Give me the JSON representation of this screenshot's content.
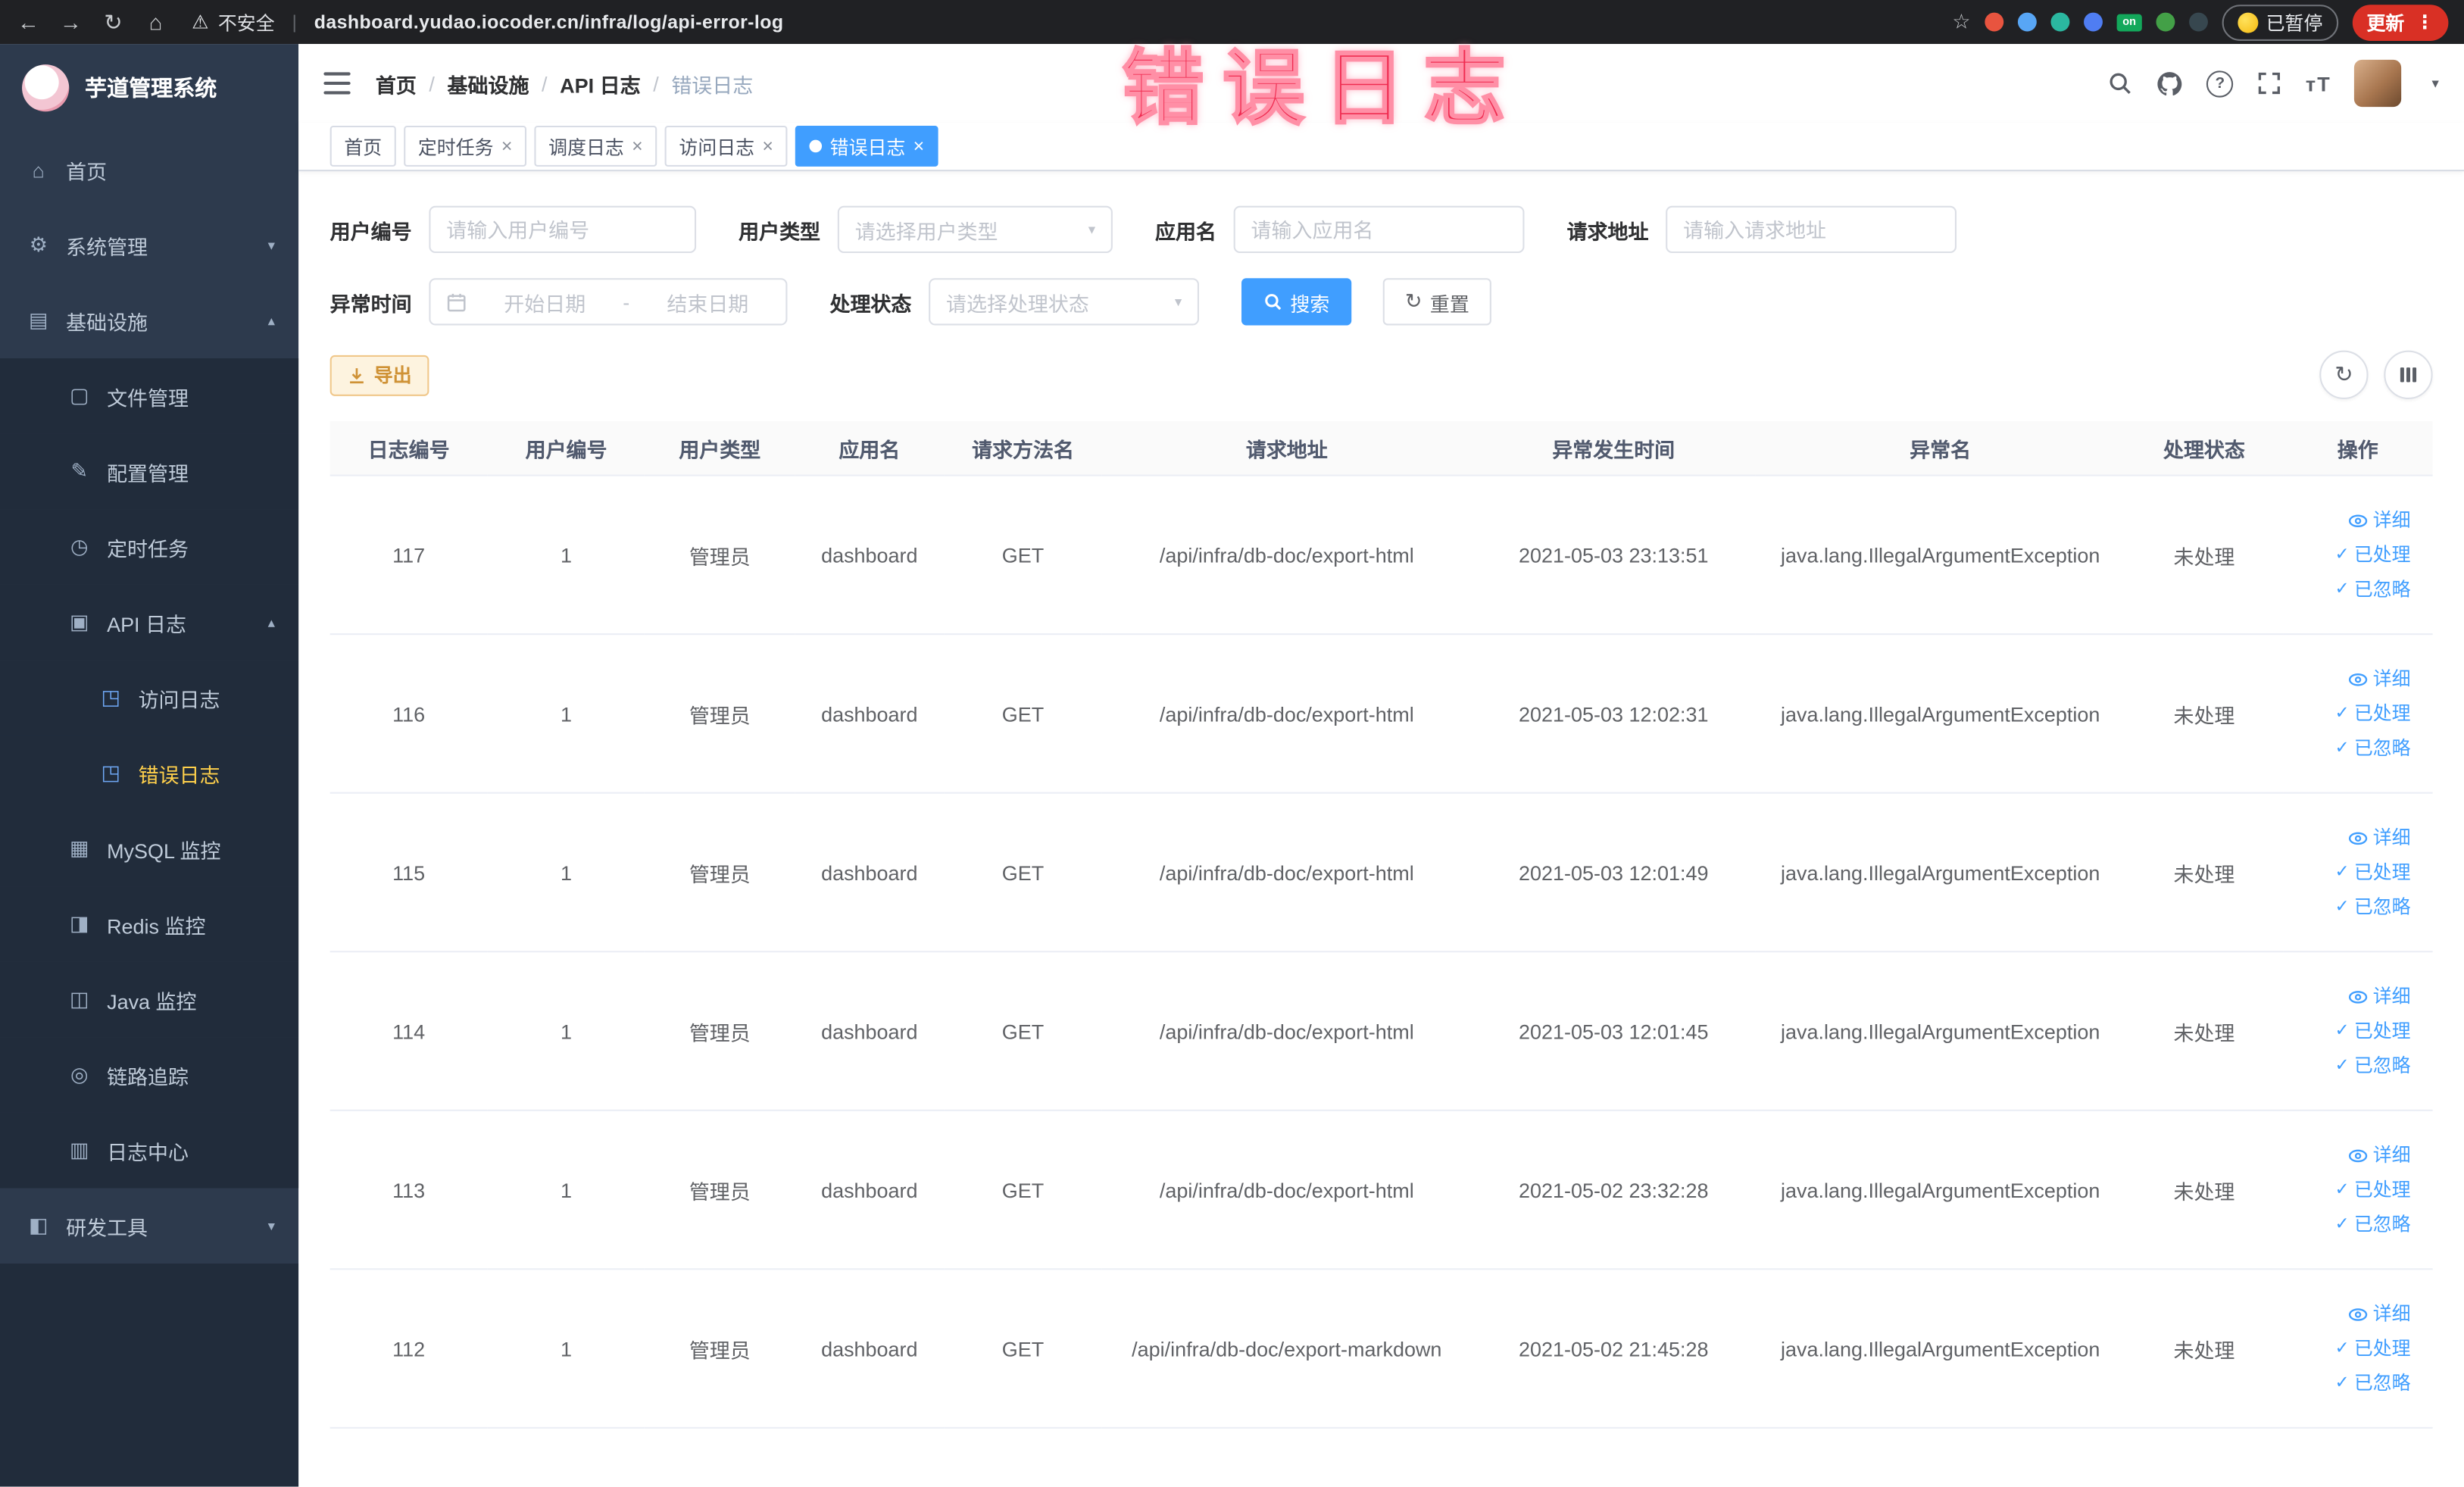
{
  "browser": {
    "back_glyph": "←",
    "forward_glyph": "→",
    "reload_glyph": "↻",
    "home_glyph": "⌂",
    "warning_glyph": "⚠",
    "security_warning": "不安全",
    "url": "dashboard.yudao.iocoder.cn/infra/log/api-error-log",
    "star_glyph": "☆",
    "extensions": [
      {
        "name": "extension-red",
        "color": "#e8543f"
      },
      {
        "name": "extension-blue",
        "color": "#58a6f5"
      },
      {
        "name": "extension-teal",
        "color": "#2bb7a0"
      },
      {
        "name": "extension-grid",
        "color": "#4f7df2"
      },
      {
        "name": "extension-on-badge",
        "color": "#13a85b",
        "text": "on"
      },
      {
        "name": "extension-green",
        "color": "#43a047"
      },
      {
        "name": "extension-dark",
        "color": "#37474f"
      }
    ],
    "paused_label": "已暂停",
    "update_label": "更新",
    "menu_dots_glyph": "⋮"
  },
  "overlay_title": "错误日志",
  "sidebar": {
    "logo_title": "芋道管理系统",
    "chevron_up": "▴",
    "chevron_down": "▾",
    "icon_glyphs": {
      "home-icon": "⌂",
      "gear-icon": "⚙",
      "infrastructure-icon": "▤",
      "file-icon": "▢",
      "config-icon": "✎",
      "timer-icon": "◷",
      "api-log-icon": "▣",
      "access-log-icon": "◳",
      "error-log-icon": "◳",
      "mysql-icon": "▦",
      "redis-icon": "◨",
      "java-icon": "◫",
      "tracing-icon": "◎",
      "log-center-icon": "▥",
      "dev-tools-icon": "◧"
    },
    "items": [
      {
        "name": "home",
        "label": "首页",
        "icon": "home-icon",
        "level": 1
      },
      {
        "name": "system-management",
        "label": "系统管理",
        "icon": "gear-icon",
        "level": 1,
        "chevron": "down"
      },
      {
        "name": "infrastructure",
        "label": "基础设施",
        "icon": "infrastructure-icon",
        "level": 1,
        "chevron": "up"
      },
      {
        "name": "file-management",
        "label": "文件管理",
        "icon": "file-icon",
        "level": 2,
        "group": true
      },
      {
        "name": "config-management",
        "label": "配置管理",
        "icon": "config-icon",
        "level": 2,
        "group": true
      },
      {
        "name": "scheduled-tasks",
        "label": "定时任务",
        "icon": "timer-icon",
        "level": 2,
        "group": true
      },
      {
        "name": "api-log",
        "label": "API 日志",
        "icon": "api-log-icon",
        "level": 2,
        "group": true,
        "chevron": "up"
      },
      {
        "name": "access-log",
        "label": "访问日志",
        "icon": "access-log-icon",
        "level": 3,
        "group": true
      },
      {
        "name": "error-log",
        "label": "错误日志",
        "icon": "error-log-icon",
        "level": 3,
        "group": true,
        "active": true
      },
      {
        "name": "mysql-monitor",
        "label": "MySQL 监控",
        "icon": "mysql-icon",
        "level": 2,
        "group": true
      },
      {
        "name": "redis-monitor",
        "label": "Redis 监控",
        "icon": "redis-icon",
        "level": 2,
        "group": true
      },
      {
        "name": "java-monitor",
        "label": "Java 监控",
        "icon": "java-icon",
        "level": 2,
        "group": true
      },
      {
        "name": "link-tracing",
        "label": "链路追踪",
        "icon": "tracing-icon",
        "level": 2,
        "group": true
      },
      {
        "name": "log-center",
        "label": "日志中心",
        "icon": "log-center-icon",
        "level": 2,
        "group": true
      },
      {
        "name": "dev-tools",
        "label": "研发工具",
        "icon": "dev-tools-icon",
        "level": 1,
        "chevron": "down"
      }
    ]
  },
  "navbar": {
    "breadcrumb": [
      "首页",
      "基础设施",
      "API 日志",
      "错误日志"
    ],
    "separator": "/"
  },
  "tabs": [
    {
      "label": "首页",
      "closable": false,
      "active": false
    },
    {
      "label": "定时任务",
      "closable": true,
      "active": false
    },
    {
      "label": "调度日志",
      "closable": true,
      "active": false
    },
    {
      "label": "访问日志",
      "closable": true,
      "active": false
    },
    {
      "label": "错误日志",
      "closable": true,
      "active": true
    }
  ],
  "filters": {
    "user_id_label": "用户编号",
    "user_id_placeholder": "请输入用户编号",
    "user_type_label": "用户类型",
    "user_type_placeholder": "请选择用户类型",
    "app_name_label": "应用名",
    "app_name_placeholder": "请输入应用名",
    "request_url_label": "请求地址",
    "request_url_placeholder": "请输入请求地址",
    "exception_time_label": "异常时间",
    "date_start_placeholder": "开始日期",
    "date_separator": "-",
    "date_end_placeholder": "结束日期",
    "process_status_label": "处理状态",
    "process_status_placeholder": "请选择处理状态",
    "search_label": "搜索",
    "reset_label": "重置"
  },
  "toolbar": {
    "export_label": "导出"
  },
  "table": {
    "columns": [
      "日志编号",
      "用户编号",
      "用户类型",
      "应用名",
      "请求方法名",
      "请求地址",
      "异常发生时间",
      "异常名",
      "处理状态",
      "操作"
    ],
    "action_labels": [
      "详细",
      "已处理",
      "已忽略"
    ],
    "rows": [
      {
        "id": "117",
        "user_id": "1",
        "user_type": "管理员",
        "app": "dashboard",
        "method": "GET",
        "url": "/api/infra/db-doc/export-html",
        "time": "2021-05-03 23:13:51",
        "exception": "java.lang.IllegalArgumentException",
        "status": "未处理"
      },
      {
        "id": "116",
        "user_id": "1",
        "user_type": "管理员",
        "app": "dashboard",
        "method": "GET",
        "url": "/api/infra/db-doc/export-html",
        "time": "2021-05-03 12:02:31",
        "exception": "java.lang.IllegalArgumentException",
        "status": "未处理"
      },
      {
        "id": "115",
        "user_id": "1",
        "user_type": "管理员",
        "app": "dashboard",
        "method": "GET",
        "url": "/api/infra/db-doc/export-html",
        "time": "2021-05-03 12:01:49",
        "exception": "java.lang.IllegalArgumentException",
        "status": "未处理"
      },
      {
        "id": "114",
        "user_id": "1",
        "user_type": "管理员",
        "app": "dashboard",
        "method": "GET",
        "url": "/api/infra/db-doc/export-html",
        "time": "2021-05-03 12:01:45",
        "exception": "java.lang.IllegalArgumentException",
        "status": "未处理"
      },
      {
        "id": "113",
        "user_id": "1",
        "user_type": "管理员",
        "app": "dashboard",
        "method": "GET",
        "url": "/api/infra/db-doc/export-html",
        "time": "2021-05-02 23:32:28",
        "exception": "java.lang.IllegalArgumentException",
        "status": "未处理"
      },
      {
        "id": "112",
        "user_id": "1",
        "user_type": "管理员",
        "app": "dashboard",
        "method": "GET",
        "url": "/api/infra/db-doc/export-markdown",
        "time": "2021-05-02 21:45:28",
        "exception": "java.lang.IllegalArgumentException",
        "status": "未处理"
      }
    ]
  },
  "colors": {
    "accent": "#409eff",
    "sidebar_active_text": "#ffd04b",
    "export_text": "#cf9236",
    "overlay_red": "#ef2b50",
    "update_button": "#d93025"
  }
}
